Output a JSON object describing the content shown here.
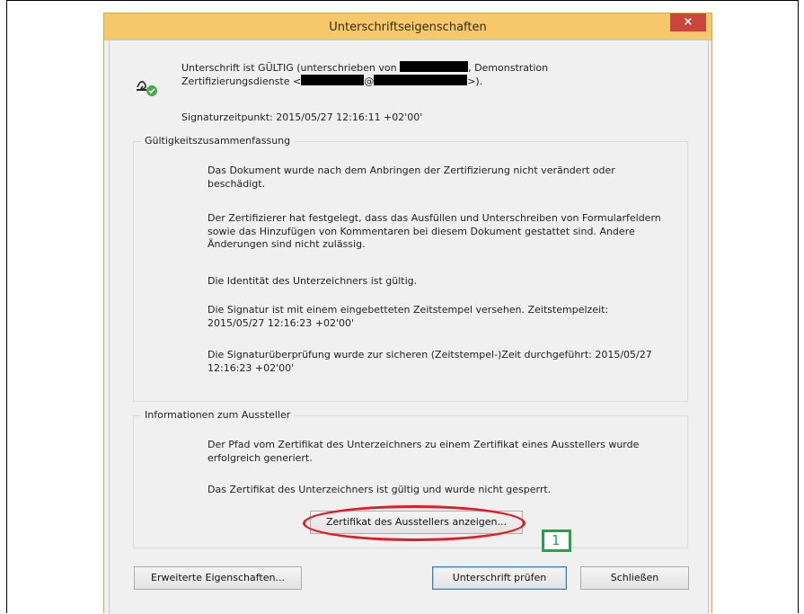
{
  "window": {
    "title": "Unterschriftseigenschaften",
    "close_glyph": "×"
  },
  "status": {
    "line1_prefix": "Unterschrift ist GÜLTIG (unterschrieben von",
    "line1_suffix": ", Demonstration",
    "line2_prefix": "Zertifizierungsdienste <",
    "line2_at": "@",
    "line2_suffix": ">).",
    "signing_time": "Signaturzeitpunkt:  2015/05/27 12:16:11 +02'00'"
  },
  "validity": {
    "label": "Gültigkeitszusammenfassung",
    "paragraphs": [
      "Das Dokument wurde nach dem Anbringen der Zertifizierung nicht verändert oder beschädigt.",
      "Der Zertifizierer hat festgelegt, dass das Ausfüllen und Unterschreiben von Formularfeldern sowie das Hinzufügen von Kommentaren bei diesem Dokument gestattet sind. Andere Änderungen sind nicht zulässig.",
      "Die Identität des Unterzeichners ist gültig.",
      "Die Signatur ist mit einem eingebetteten Zeitstempel versehen. Zeitstempelzeit: 2015/05/27 12:16:23 +02'00'",
      "Die Signaturüberprüfung wurde zur sicheren (Zeitstempel-)Zeit durchgeführt: 2015/05/27 12:16:23 +02'00'"
    ]
  },
  "issuer": {
    "label": "Informationen zum Aussteller",
    "paragraphs": [
      "Der Pfad vom Zertifikat des Unterzeichners zu einem Zertifikat eines Ausstellers wurde erfolgreich generiert.",
      "Das Zertifikat des Unterzeichners ist gültig und wurde nicht gesperrt."
    ],
    "show_cert_button": "Zertifikat des Ausstellers anzeigen..."
  },
  "footer": {
    "advanced_button": "Erweiterte Eigenschaften...",
    "verify_button": "Unterschrift prüfen",
    "close_button": "Schließen"
  },
  "annotation": {
    "marker_number": "1",
    "ellipse_color": "#e31b23",
    "marker_color": "#1fa64b"
  },
  "icons": {
    "signature": "signature-valid-icon"
  }
}
